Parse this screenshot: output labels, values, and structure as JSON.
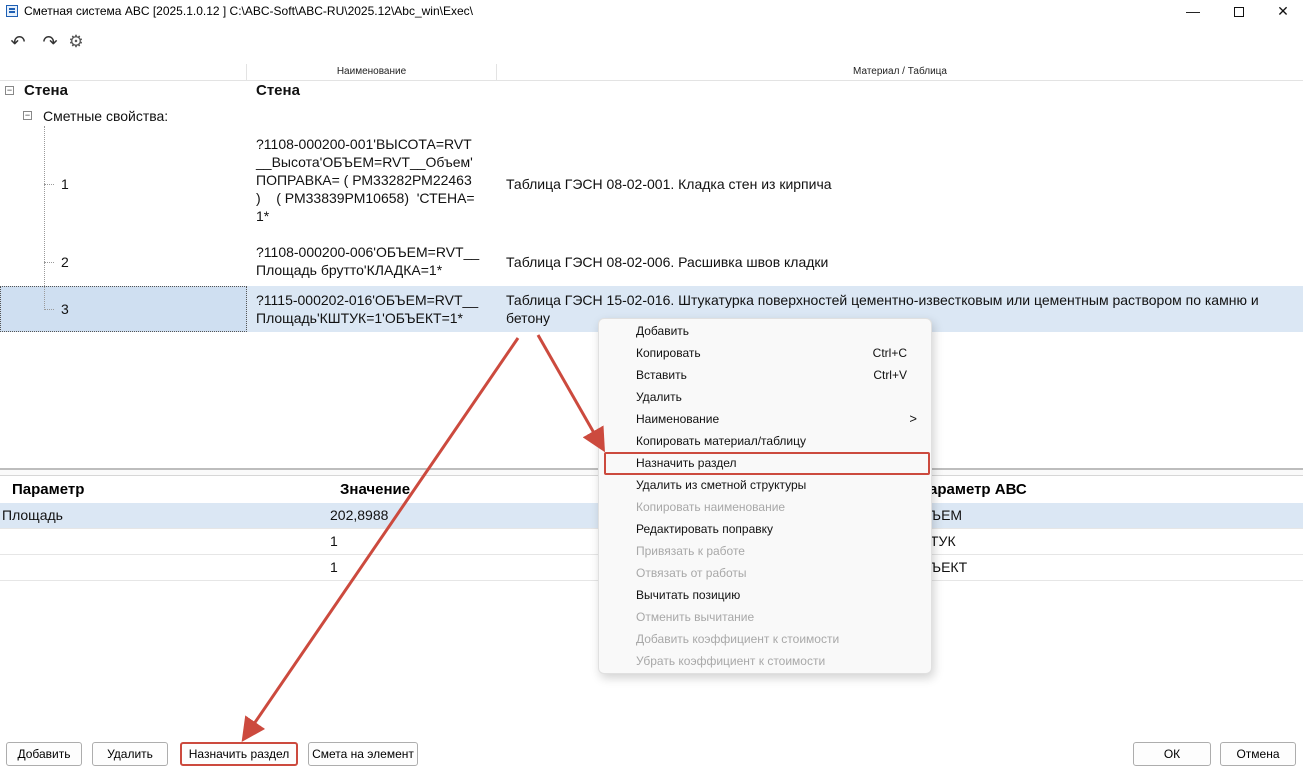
{
  "window": {
    "title": "Сметная система ABC [2025.1.0.12 ]   C:\\ABC-Soft\\ABC-RU\\2025.12\\Abc_win\\Exec\\",
    "minimize": "—",
    "close": "✕"
  },
  "toolbar": {
    "undo": "↶",
    "redo": "↷",
    "settings": "⚙"
  },
  "tree": {
    "headers": [
      "",
      "Наименование",
      "Материал / Таблица"
    ],
    "root_label": "Стена",
    "root_name": "Стена",
    "group_label": "Сметные свойства:",
    "rows": [
      {
        "num": "1",
        "name_lines": [
          "?1108-000200-001'ВЫСОТА=RVT",
          "__Высота'ОБЪЕМ=RVT__Объем'",
          "ПОПРАВКА= ( РМ33282РМ22463",
          ")    ( РМ33839РМ10658)  'СТЕНА=",
          "1*"
        ],
        "material": "Таблица ГЭСН 08-02-001. Кладка стен из кирпича"
      },
      {
        "num": "2",
        "name_lines": [
          "?1108-000200-006'ОБЪЕМ=RVT__",
          "Площадь брутто'КЛАДКА=1*"
        ],
        "material": "Таблица ГЭСН 08-02-006. Расшивка швов кладки"
      },
      {
        "num": "3",
        "name_lines": [
          "?1115-000202-016'ОБЪЕМ=RVT__",
          "Площадь'КШТУК=1'ОБЪЕКТ=1*"
        ],
        "material_lines": [
          "Таблица ГЭСН 15-02-016. Штукатурка поверхностей цементно-известковым или цементным раствором по камню и",
          "бетону"
        ]
      }
    ]
  },
  "params": {
    "headers": [
      "Параметр",
      "Значение",
      "араметр АВС"
    ],
    "rows": [
      {
        "param": "Площадь",
        "value": "202,8988",
        "abc": "ЪЕМ"
      },
      {
        "param": "",
        "value": "1",
        "abc": "ТУК"
      },
      {
        "param": "",
        "value": "1",
        "abc": "ЪЕКТ"
      }
    ]
  },
  "context_menu": {
    "items": [
      {
        "label": "Добавить",
        "shortcut": "",
        "disabled": false
      },
      {
        "label": "Копировать",
        "shortcut": "Ctrl+C",
        "disabled": false
      },
      {
        "label": "Вставить",
        "shortcut": "Ctrl+V",
        "disabled": false
      },
      {
        "label": "Удалить",
        "shortcut": "",
        "disabled": false
      },
      {
        "label": "Наименование",
        "shortcut": "",
        "submenu": ">",
        "disabled": false
      },
      {
        "label": "Копировать материал/таблицу",
        "shortcut": "",
        "disabled": false
      },
      {
        "label": "Назначить раздел",
        "shortcut": "",
        "disabled": false,
        "highlighted": true
      },
      {
        "label": "Удалить из сметной структуры",
        "shortcut": "",
        "disabled": false
      },
      {
        "label": "Копировать наименование",
        "shortcut": "",
        "disabled": true
      },
      {
        "label": "Редактировать поправку",
        "shortcut": "",
        "disabled": false
      },
      {
        "label": "Привязать к работе",
        "shortcut": "",
        "disabled": true
      },
      {
        "label": "Отвязать от работы",
        "shortcut": "",
        "disabled": true
      },
      {
        "label": "Вычитать позицию",
        "shortcut": "",
        "disabled": false
      },
      {
        "label": "Отменить вычитание",
        "shortcut": "",
        "disabled": true
      },
      {
        "label": "Добавить коэффициент к стоимости",
        "shortcut": "",
        "disabled": true
      },
      {
        "label": "Убрать коэффициент к стоимости",
        "shortcut": "",
        "disabled": true
      }
    ]
  },
  "buttons": {
    "add": "Добавить",
    "delete": "Удалить",
    "assign_section": "Назначить раздел",
    "estimate_element": "Смета на элемент",
    "ok": "ОК",
    "cancel": "Отмена"
  },
  "colors": {
    "selection": "#dbe7f4",
    "annotation_red": "#cc4a3e"
  }
}
